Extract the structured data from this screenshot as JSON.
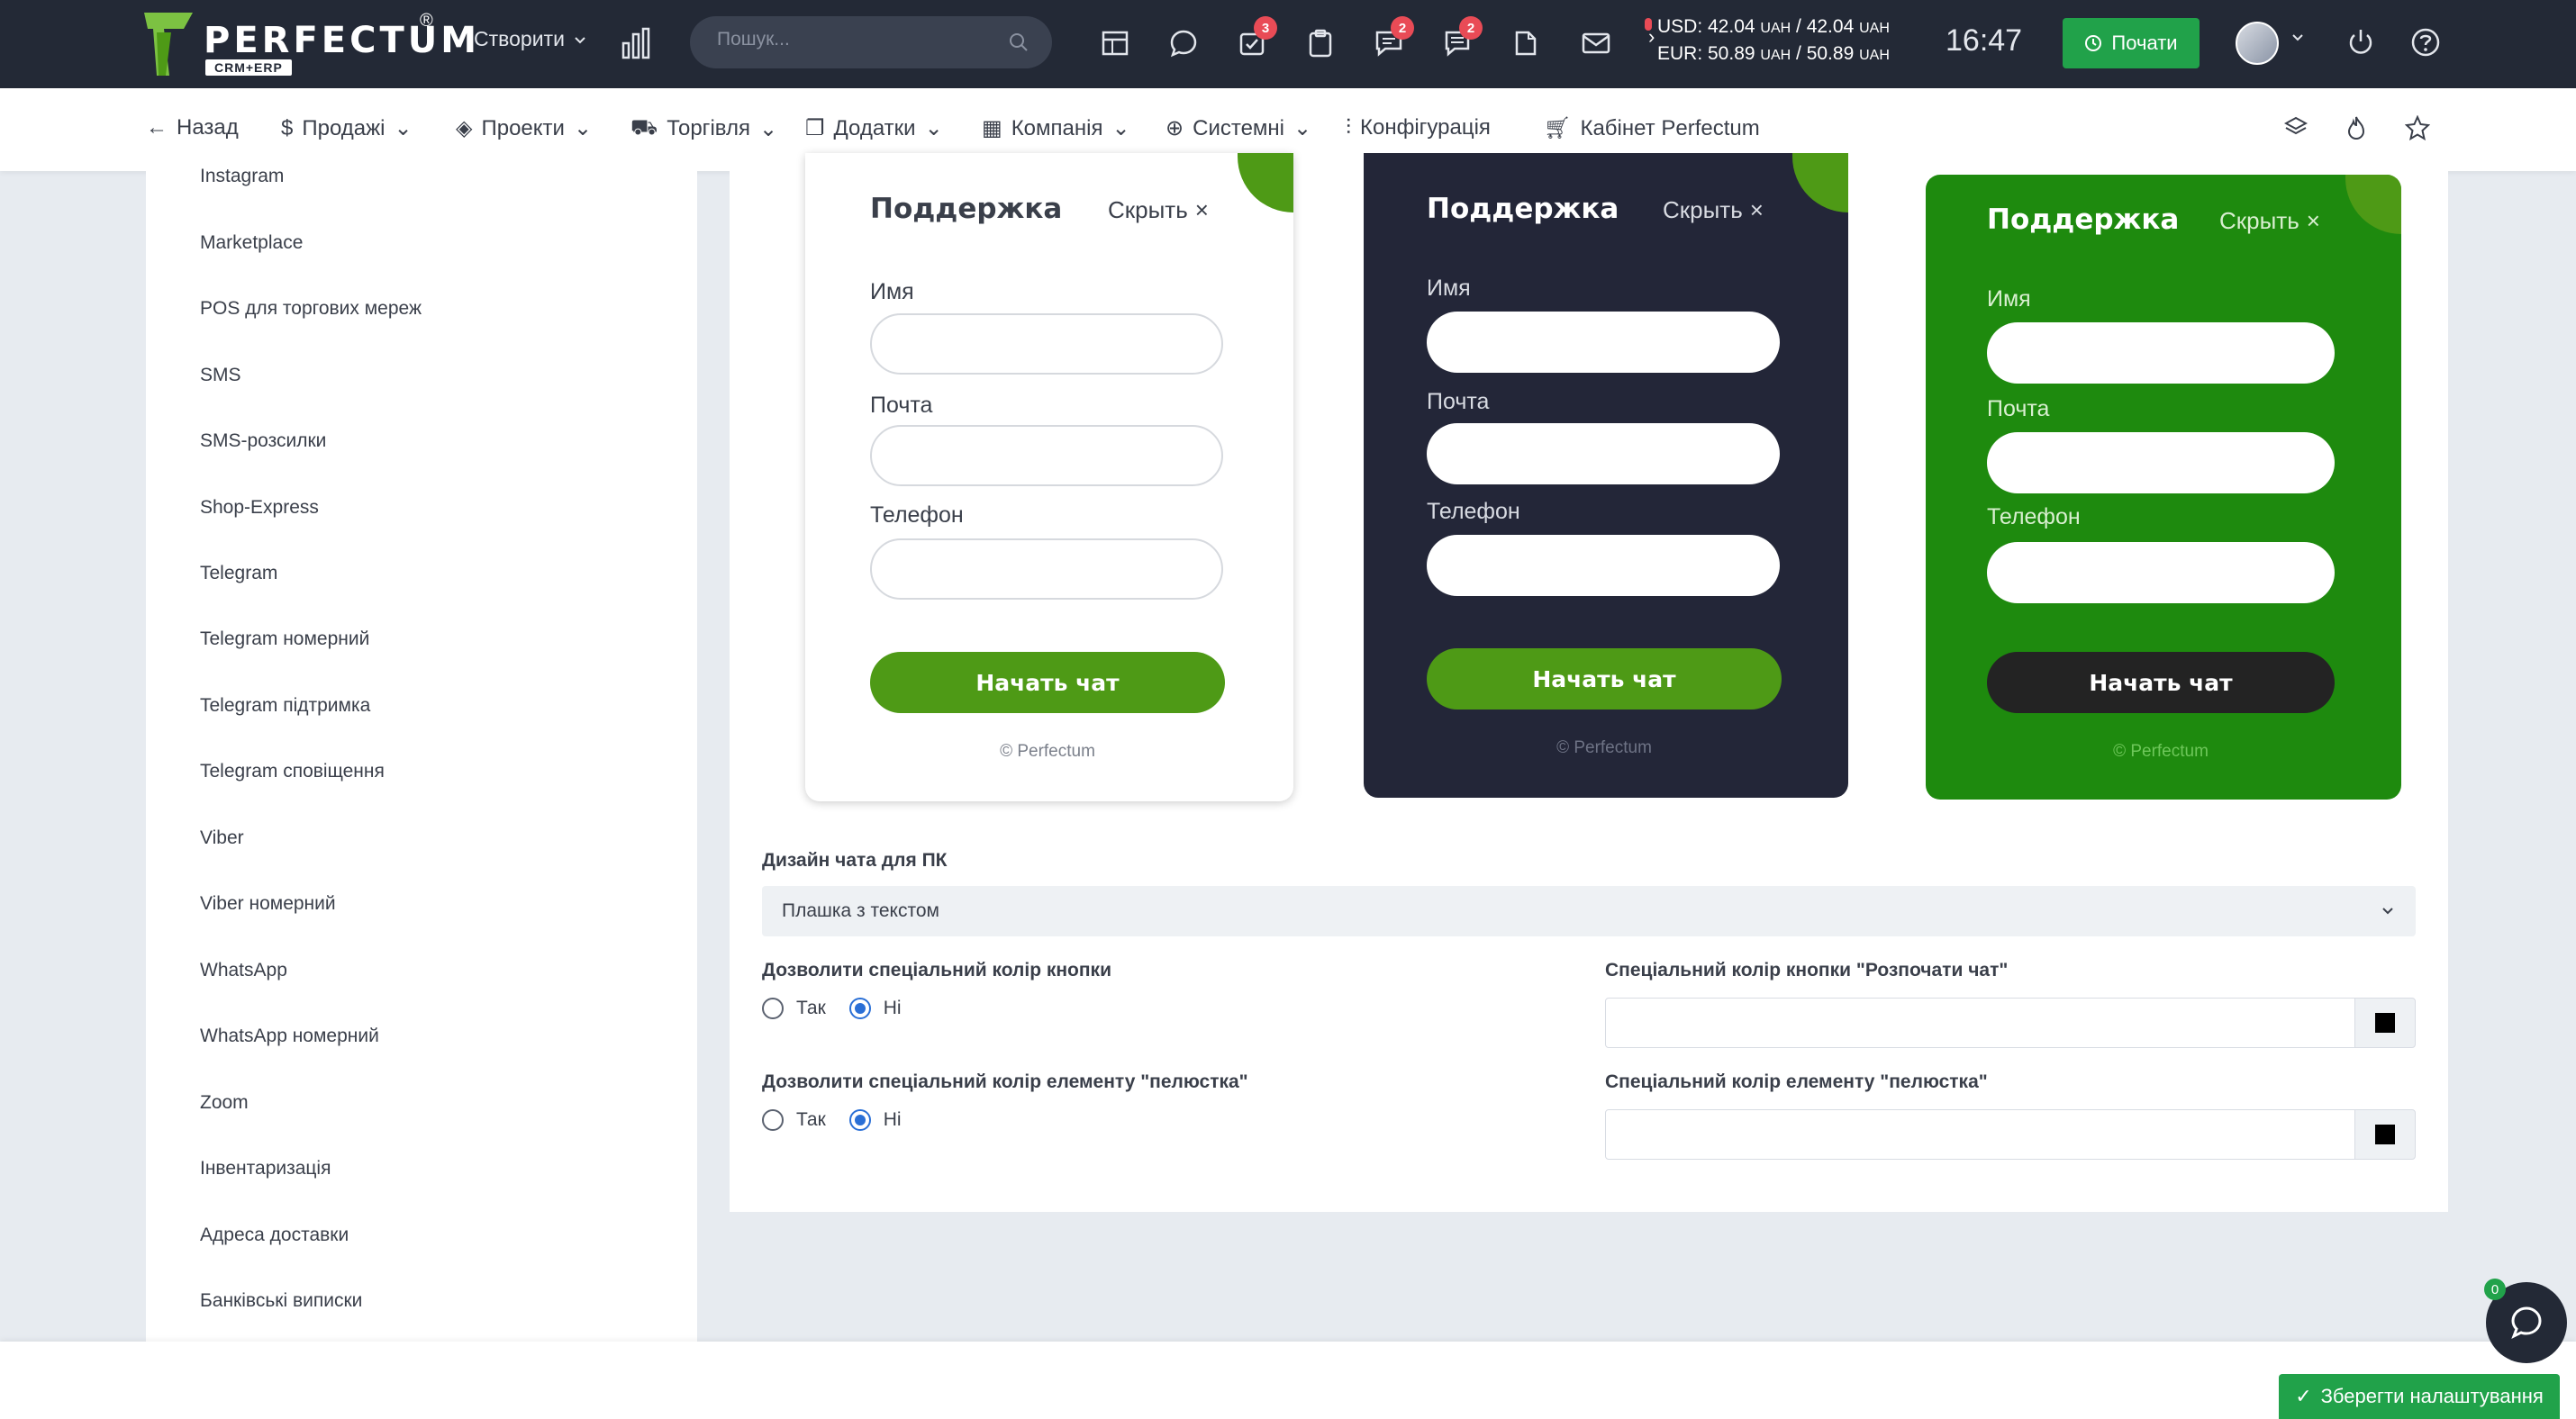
{
  "header": {
    "logo_text": "PERFECTUM",
    "logo_reg": "®",
    "logo_sub": "CRM+ERP",
    "create_label": "Створити",
    "search_placeholder": "Пошук...",
    "badges": {
      "tasks": "3",
      "chat": "2",
      "comments": "2"
    },
    "fx": {
      "usd_label": "USD: 42.04",
      "usd_unit1": "UAH",
      "usd_sep": "/ 42.04",
      "usd_unit2": "UAH",
      "eur_label": "EUR: 50.89",
      "eur_unit1": "UAH",
      "eur_sep": "/ 50.89",
      "eur_unit2": "UAH"
    },
    "time": "16:47",
    "start_label": "Почати"
  },
  "nav": {
    "back": "Назад",
    "sales": "Продажі",
    "projects": "Проекти",
    "trade": "Торгівля",
    "addons": "Додатки",
    "company": "Компанія",
    "system": "Системні",
    "config": "Конфігурація",
    "cabinet": "Кабінет Perfectum"
  },
  "sidebar": {
    "items": [
      "Instagram",
      "Marketplace",
      "POS для торгових мереж",
      "SMS",
      "SMS-розсилки",
      "Shop-Express",
      "Telegram",
      "Telegram номерний",
      "Telegram підтримка",
      "Telegram сповіщення",
      "Viber",
      "Viber номерний",
      "WhatsApp",
      "WhatsApp номерний",
      "Zoom",
      "Інвентаризація",
      "Адреса доставки",
      "Банківські виписки"
    ]
  },
  "widgets": {
    "title": "Поддержка",
    "hide": "Скрыть",
    "name": "Имя",
    "email": "Почта",
    "phone": "Телефон",
    "start": "Начать чат",
    "copyright": "© Perfectum"
  },
  "form": {
    "design_label": "Дизайн чата для ПК",
    "design_value": "Плашка з текстом",
    "allow_button_color": "Дозволити спеціальний колір кнопки",
    "allow_petal_color": "Дозволити спеціальний колір елементу \"пелюстка\"",
    "yes": "Так",
    "no": "Ні",
    "button_color_label": "Спеціальний колір кнопки \"Розпочати чат\"",
    "petal_color_label": "Спеціальний колір елементу \"пелюстка\""
  },
  "footer": {
    "save_label": "Зберегти налаштування",
    "chat_badge": "0"
  },
  "colors": {
    "topbar": "#232936",
    "accent_green": "#21a24a",
    "widget_green": "#1e8a0e",
    "button_green": "#4e9a16",
    "dark_widget": "#232638"
  }
}
